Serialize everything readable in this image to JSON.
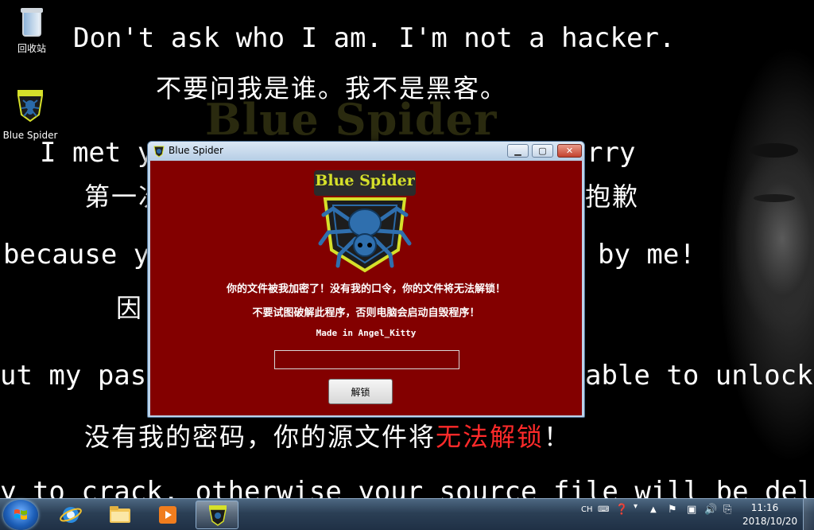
{
  "desktop": {
    "watermark": "Blue Spider",
    "lines": [
      {
        "text": "Don't ask who I am. I'm not a hacker."
      },
      {
        "text": "不要问我是谁。我不是黑客。"
      },
      {
        "text": "I met yo"
      },
      {
        "text": "rry"
      },
      {
        "text": "第一次"
      },
      {
        "text": "抱歉"
      },
      {
        "text": "because you"
      },
      {
        "text": "by me!"
      },
      {
        "text": "因"
      },
      {
        "text": "ut my passwo"
      },
      {
        "text": "able to unlock!"
      },
      {
        "text": "没有我的密码，你的源文件将"
      },
      {
        "text": "无法解锁"
      },
      {
        "text": "！"
      },
      {
        "text": "y to crack, otherwise your source file will be deleted"
      }
    ],
    "icons": [
      {
        "label": "回收站"
      },
      {
        "label": "Blue Spider"
      }
    ]
  },
  "dialog": {
    "title": "Blue Spider",
    "logo_text": "Blue Spider",
    "message_1": "你的文件被我加密了！没有我的口令，你的文件将无法解锁！",
    "message_2": "不要试图破解此程序，否则电脑会启动自毁程序！",
    "credit": "Made in Angel_Kitty",
    "password_value": "",
    "unlock_label": "解锁"
  },
  "taskbar": {
    "apps": [
      {
        "icon": "internet-explorer-icon"
      },
      {
        "icon": "folder-icon"
      },
      {
        "icon": "media-player-icon"
      },
      {
        "icon": "blue-spider-icon"
      }
    ],
    "tray": {
      "lang": "CH",
      "time": "11:16",
      "date": "2018/10/20"
    }
  },
  "colors": {
    "dialog_bg": "#830000",
    "logo_yellow": "#d6e02a",
    "accent_red": "#ff2a2a"
  }
}
